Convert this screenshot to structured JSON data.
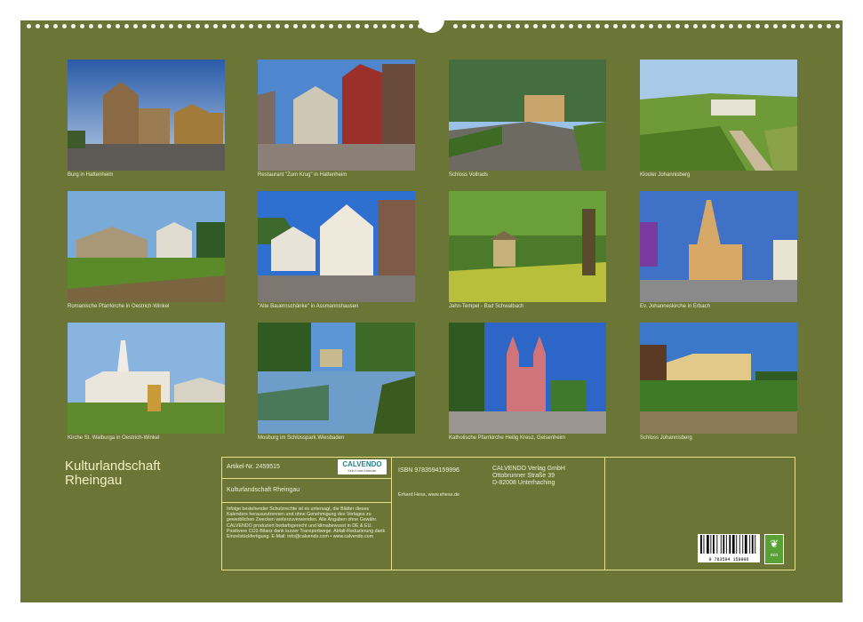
{
  "calendar": {
    "title_line1": "Kulturlandschaft",
    "title_line2": "Rheingau"
  },
  "photos": [
    {
      "caption": "Burg in Hattenheim"
    },
    {
      "caption": "Restaurant \"Zum Krug\" in Hattenheim"
    },
    {
      "caption": "Schloss Vollrads"
    },
    {
      "caption": "Kloster Johannisberg"
    },
    {
      "caption": "Romanische Pfarrkirche in Oestrich-Winkel"
    },
    {
      "caption": "\"Alte Bauernschänke\" in Assmannshausen"
    },
    {
      "caption": "Jahn-Tempel - Bad Schwalbach"
    },
    {
      "caption": "Ev. Johanneskirche in Erbach"
    },
    {
      "caption": "Kirche St. Walburga in Oestrich-Winkel"
    },
    {
      "caption": "Mosburg im Schlosspark Wiesbaden"
    },
    {
      "caption": "Katholische Pfarrkirche Heilig Kreuz, Geisenheim"
    },
    {
      "caption": "Schloss Johannisberg"
    }
  ],
  "info": {
    "article_label": "Artikel-Nr. 2459515",
    "brand": "CALVENDO",
    "brand_sub": "Kein Kunst-Kalender",
    "title": "Kulturlandschaft Rheingau",
    "legal": "Infolge bestehender Schutzrechte ist es untersagt, die Blätter dieses Kalenders herauszutrennen und ohne Genehmigung des Verlages zu gewerblichen Zwecken weiterzuverwenden. Alle Angaben ohne Gewähr. CALVENDO produziert bedarfsgerecht und klimabewusst in DE & EU. Positivere CO2-Bilanz dank kurzer Transportwege. Abfall-Reduzierung dank Einzelstückfertigung. E-Mail: info@calvendo.com • www.calvendo.com",
    "isbn": "ISBN 9783594159996",
    "author": "Erhard Hess, www.ehess.de",
    "publisher_1": "CALVENDO Verlag GmbH",
    "publisher_2": "Ottobrunner Straße 39",
    "publisher_3": "D-82008 Unterhaching",
    "barcode_number": "9 783594 159996",
    "eco_label": "eco"
  }
}
